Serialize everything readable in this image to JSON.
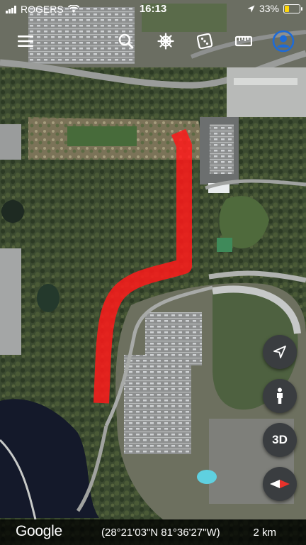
{
  "status_bar": {
    "carrier": "ROGERS",
    "time": "16:13",
    "battery": "33%",
    "battery_level": 0.33,
    "battery_color": "#ffd60a"
  },
  "toolbar": {
    "icons": [
      "menu-icon",
      "search-icon",
      "voyager-wheel-icon",
      "dice-icon",
      "ruler-icon",
      "profile-icon"
    ],
    "profile_color": "#1e6bd6"
  },
  "controls": {
    "locate_icon": "location-arrow-icon",
    "street_view_icon": "pegman-icon",
    "view_toggle": "3D",
    "compass_icon": "compass-icon",
    "compass_north_color": "#e8322b"
  },
  "bottom_bar": {
    "logo": "Google",
    "coordinates": "(28°21'03\"N 81°36'27\"W)",
    "scale": "2 km"
  },
  "route": {
    "color": "#ff1a1a"
  }
}
